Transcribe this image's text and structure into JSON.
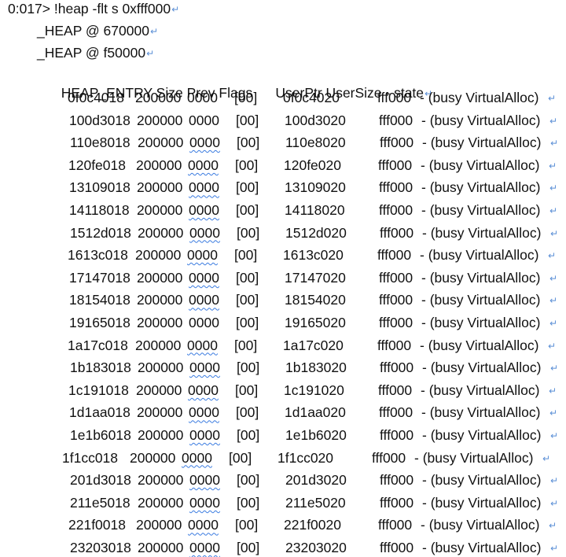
{
  "command": "0:017> !heap -flt s 0xfff000",
  "heaps": [
    "_HEAP @ 670000",
    "_HEAP @ f50000"
  ],
  "header": "HEAP_ENTRY Size Prev Flags      UserPtr UserSize - state",
  "return_mark": "↵",
  "rows": [
    {
      "entry": "0f0c4018",
      "size": "200000",
      "prev": "0000",
      "flags": "[00]",
      "userptr": "0f0c4020",
      "usersize": "fff000",
      "state": "- (busy VirtualAlloc)",
      "squiggle": false
    },
    {
      "entry": "100d3018",
      "size": "200000",
      "prev": "0000",
      "flags": "[00]",
      "userptr": "100d3020",
      "usersize": "fff000",
      "state": "- (busy VirtualAlloc)",
      "squiggle": false
    },
    {
      "entry": "110e8018",
      "size": "200000",
      "prev": "0000",
      "flags": "[00]",
      "userptr": "110e8020",
      "usersize": "fff000",
      "state": "- (busy VirtualAlloc)",
      "squiggle": true
    },
    {
      "entry": "120fe018",
      "size": "200000",
      "prev": "0000",
      "flags": "[00]",
      "userptr": "120fe020",
      "usersize": "fff000",
      "state": "- (busy VirtualAlloc)",
      "squiggle": true
    },
    {
      "entry": "13109018",
      "size": "200000",
      "prev": "0000",
      "flags": "[00]",
      "userptr": "13109020",
      "usersize": "fff000",
      "state": "- (busy VirtualAlloc)",
      "squiggle": true
    },
    {
      "entry": "14118018",
      "size": "200000",
      "prev": "0000",
      "flags": "[00]",
      "userptr": "14118020",
      "usersize": "fff000",
      "state": "- (busy VirtualAlloc)",
      "squiggle": true
    },
    {
      "entry": "1512d018",
      "size": "200000",
      "prev": "0000",
      "flags": "[00]",
      "userptr": "1512d020",
      "usersize": "fff000",
      "state": "- (busy VirtualAlloc)",
      "squiggle": true
    },
    {
      "entry": "1613c018",
      "size": "200000",
      "prev": "0000",
      "flags": "[00]",
      "userptr": "1613c020",
      "usersize": "fff000",
      "state": "- (busy VirtualAlloc)",
      "squiggle": true
    },
    {
      "entry": "17147018",
      "size": "200000",
      "prev": "0000",
      "flags": "[00]",
      "userptr": "17147020",
      "usersize": "fff000",
      "state": "- (busy VirtualAlloc)",
      "squiggle": true
    },
    {
      "entry": "18154018",
      "size": "200000",
      "prev": "0000",
      "flags": "[00]",
      "userptr": "18154020",
      "usersize": "fff000",
      "state": "- (busy VirtualAlloc)",
      "squiggle": true
    },
    {
      "entry": "19165018",
      "size": "200000",
      "prev": "0000",
      "flags": "[00]",
      "userptr": "19165020",
      "usersize": "fff000",
      "state": "- (busy VirtualAlloc)",
      "squiggle": false
    },
    {
      "entry": "1a17c018",
      "size": "200000",
      "prev": "0000",
      "flags": "[00]",
      "userptr": "1a17c020",
      "usersize": "fff000",
      "state": "- (busy VirtualAlloc)",
      "squiggle": true
    },
    {
      "entry": "1b183018",
      "size": "200000",
      "prev": "0000",
      "flags": "[00]",
      "userptr": "1b183020",
      "usersize": "fff000",
      "state": "- (busy VirtualAlloc)",
      "squiggle": true
    },
    {
      "entry": "1c191018",
      "size": "200000",
      "prev": "0000",
      "flags": "[00]",
      "userptr": "1c191020",
      "usersize": "fff000",
      "state": "- (busy VirtualAlloc)",
      "squiggle": true
    },
    {
      "entry": "1d1aa018",
      "size": "200000",
      "prev": "0000",
      "flags": "[00]",
      "userptr": "1d1aa020",
      "usersize": "fff000",
      "state": "- (busy VirtualAlloc)",
      "squiggle": true
    },
    {
      "entry": "1e1b6018",
      "size": "200000",
      "prev": "0000",
      "flags": "[00]",
      "userptr": "1e1b6020",
      "usersize": "fff000",
      "state": "- (busy VirtualAlloc)",
      "squiggle": true
    },
    {
      "entry": "1f1cc018",
      "size": "200000",
      "prev": "0000",
      "flags": "[00]",
      "userptr": "1f1cc020",
      "usersize": "fff000",
      "state": "- (busy VirtualAlloc)",
      "squiggle": true
    },
    {
      "entry": "201d3018",
      "size": "200000",
      "prev": "0000",
      "flags": "[00]",
      "userptr": "201d3020",
      "usersize": "fff000",
      "state": "- (busy VirtualAlloc)",
      "squiggle": true
    },
    {
      "entry": "211e5018",
      "size": "200000",
      "prev": "0000",
      "flags": "[00]",
      "userptr": "211e5020",
      "usersize": "fff000",
      "state": "- (busy VirtualAlloc)",
      "squiggle": true
    },
    {
      "entry": "221f0018",
      "size": "200000",
      "prev": "0000",
      "flags": "[00]",
      "userptr": "221f0020",
      "usersize": "fff000",
      "state": "- (busy VirtualAlloc)",
      "squiggle": true
    },
    {
      "entry": "23203018",
      "size": "200000",
      "prev": "0000",
      "flags": "[00]",
      "userptr": "23203020",
      "usersize": "fff000",
      "state": "- (busy VirtualAlloc)",
      "squiggle": true
    }
  ]
}
